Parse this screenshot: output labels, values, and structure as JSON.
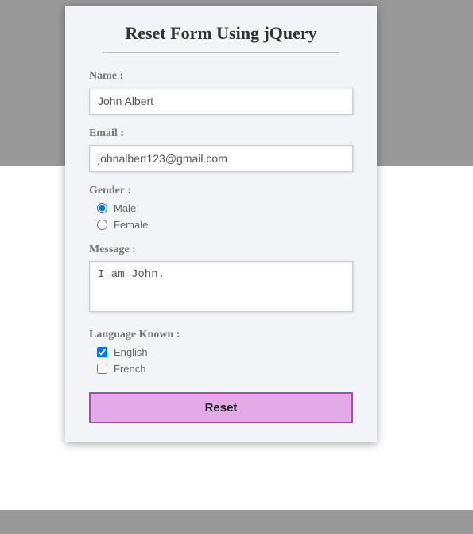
{
  "title": "Reset Form Using jQuery",
  "fields": {
    "name": {
      "label": "Name :",
      "value": "John Albert"
    },
    "email": {
      "label": "Email :",
      "value": "johnalbert123@gmail.com"
    },
    "gender": {
      "label": "Gender :",
      "options": [
        "Male",
        "Female"
      ],
      "selected": "Male"
    },
    "message": {
      "label": "Message :",
      "value": "I am John."
    },
    "language": {
      "label": "Language Known :",
      "options": [
        {
          "label": "English",
          "checked": true
        },
        {
          "label": "French",
          "checked": false
        }
      ]
    }
  },
  "button": {
    "reset": "Reset"
  }
}
